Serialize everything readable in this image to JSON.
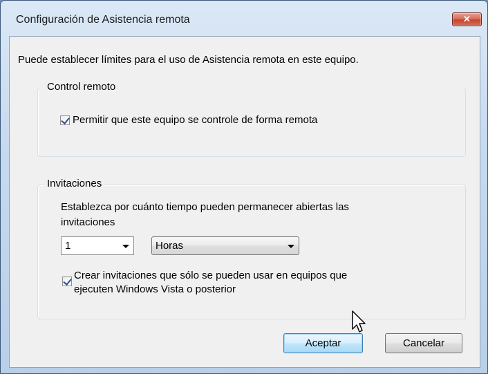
{
  "window": {
    "title": "Configuración de Asistencia remota",
    "close_glyph": "✕"
  },
  "intro_text": "Puede establecer límites para el uso de Asistencia remota en este equipo.",
  "control_remoto": {
    "legend": "Control remoto",
    "allow_checkbox": {
      "label": "Permitir que este equipo se controle de forma remota",
      "checked": true
    }
  },
  "invitaciones": {
    "legend": "Invitaciones",
    "description_line1": "Establezca por cuánto tiempo pueden permanecer abiertas las",
    "description_line2": "invitaciones",
    "duration_value": "1",
    "unit_value": "Horas",
    "vista_checkbox": {
      "label_line1": "Crear invitaciones que sólo se pueden usar en equipos que",
      "label_line2": "ejecuten Windows Vista o posterior",
      "checked": true
    }
  },
  "buttons": {
    "ok": "Aceptar",
    "cancel": "Cancelar"
  },
  "colors": {
    "frame": "#c7d9ee",
    "client": "#f0f0f0",
    "close": "#c4442c",
    "default_button": "#bee6fd"
  }
}
